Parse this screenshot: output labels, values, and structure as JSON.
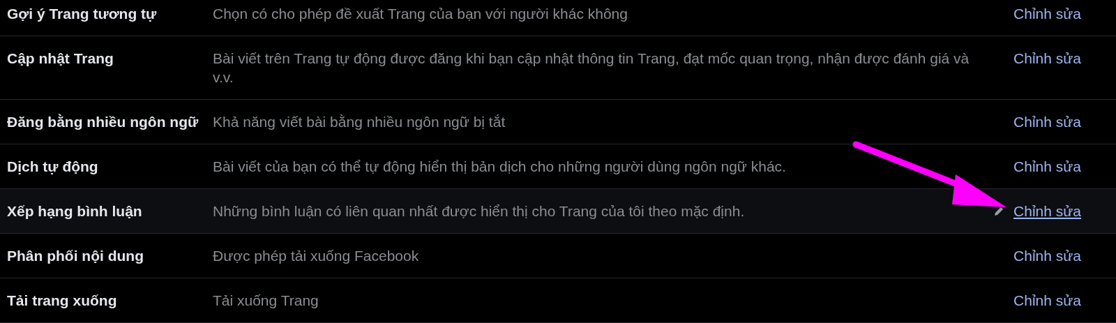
{
  "rows": [
    {
      "label": "Gợi ý Trang tương tự",
      "description": "Chọn có cho phép đề xuất Trang của bạn với người khác không",
      "action": "Chỉnh sửa",
      "hovered": false
    },
    {
      "label": "Cập nhật Trang",
      "description": "Bài viết trên Trang tự động được đăng khi bạn cập nhật thông tin Trang, đạt mốc quan trọng, nhận được đánh giá và v.v.",
      "action": "Chỉnh sửa",
      "hovered": false
    },
    {
      "label": "Đăng bằng nhiều ngôn ngữ",
      "description": "Khả năng viết bài bằng nhiều ngôn ngữ bị tắt",
      "action": "Chỉnh sửa",
      "hovered": false
    },
    {
      "label": "Dịch tự động",
      "description": "Bài viết của bạn có thể tự động hiển thị bản dịch cho những người dùng ngôn ngữ khác.",
      "action": "Chỉnh sửa",
      "hovered": false
    },
    {
      "label": "Xếp hạng bình luận",
      "description": "Những bình luận có liên quan nhất được hiển thị cho Trang của tôi theo mặc định.",
      "action": "Chỉnh sửa",
      "hovered": true
    },
    {
      "label": "Phân phối nội dung",
      "description": "Được phép tải xuống Facebook",
      "action": "Chỉnh sửa",
      "hovered": false
    },
    {
      "label": "Tải trang xuống",
      "description": "Tải xuống Trang",
      "action": "Chỉnh sửa",
      "hovered": false
    }
  ]
}
